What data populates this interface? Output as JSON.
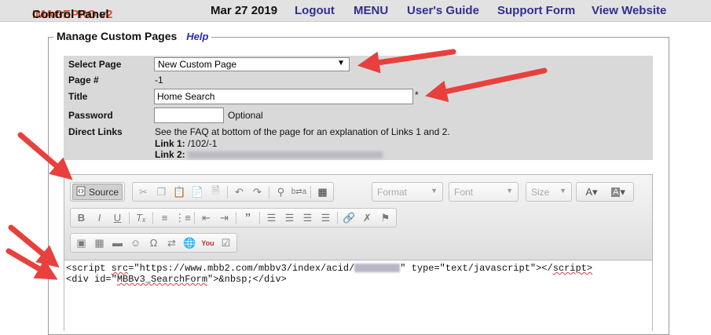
{
  "nav": {
    "brand_part1": "IMAGEPRO v2",
    "brand_part2": " Control Panel",
    "date": "Mar 27 2019",
    "links": [
      "Logout",
      "MENU",
      "User's Guide",
      "Support Form",
      "View Website"
    ]
  },
  "section": {
    "title": "Manage Custom Pages",
    "help_label": "Help"
  },
  "form": {
    "select_page_label": "Select Page",
    "select_page_value": "New Custom Page",
    "page_num_label": "Page #",
    "page_num_value": "-1",
    "title_label": "Title",
    "title_value": "Home Search",
    "required_mark": "*",
    "password_label": "Password",
    "password_value": "",
    "optional_label": "Optional",
    "direct_links_label": "Direct Links",
    "direct_links_note": "See the FAQ at bottom of the page for an explanation of Links 1 and 2.",
    "link1_label": "Link 1:",
    "link1_value": " /102/-1",
    "link2_label": "Link 2:"
  },
  "editor": {
    "source_label": "Source",
    "format_label": "Format",
    "font_label": "Font",
    "size_label": "Size",
    "line1_pre": "<script ",
    "line1_src": "src",
    "line1_mid": "=\"https://www.mbb2.com/mbbv3/index/acid/",
    "line1_post": "\" type=\"text/javascript\"></",
    "line1_end": "script>",
    "line2_pre": "<div id=\"",
    "line2_id": "MBBv3_SearchForm",
    "line2_post": "\">&nbsp;</div>"
  },
  "icons": {
    "annotation_arrow_color": "#e8403c"
  }
}
